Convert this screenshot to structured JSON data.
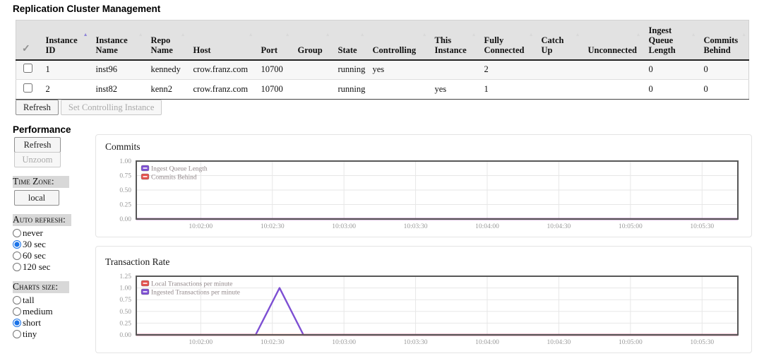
{
  "page": {
    "title": "Replication Cluster Management"
  },
  "cluster_table": {
    "select_icon": "✓",
    "columns": [
      {
        "id": "select",
        "label": "",
        "sort": null
      },
      {
        "id": "instance-id",
        "label": "Instance ID",
        "sort": "active"
      },
      {
        "id": "instance-name",
        "label": "Instance Name",
        "sort": "inactive"
      },
      {
        "id": "repo-name",
        "label": "Repo Name",
        "sort": "inactive"
      },
      {
        "id": "host",
        "label": "Host",
        "sort": "inactive"
      },
      {
        "id": "port",
        "label": "Port",
        "sort": "inactive"
      },
      {
        "id": "group",
        "label": "Group",
        "sort": "inactive"
      },
      {
        "id": "state",
        "label": "State",
        "sort": "inactive"
      },
      {
        "id": "controlling",
        "label": "Controlling",
        "sort": "inactive"
      },
      {
        "id": "this-instance",
        "label": "This Instance",
        "sort": "inactive"
      },
      {
        "id": "fully-connected",
        "label": "Fully Connected",
        "sort": "inactive"
      },
      {
        "id": "catch-up",
        "label": "Catch Up",
        "sort": "inactive"
      },
      {
        "id": "unconnected",
        "label": "Unconnected",
        "sort": "inactive"
      },
      {
        "id": "ingest-queue-length",
        "label": "Ingest Queue Length",
        "sort": "inactive"
      },
      {
        "id": "commits-behind",
        "label": "Commits Behind",
        "sort": "inactive"
      }
    ],
    "rows": [
      {
        "checked": false,
        "cells": [
          "1",
          "inst96",
          "kennedy",
          "crow.franz.com",
          "10700",
          "",
          "running",
          "yes",
          "",
          "2",
          "",
          "",
          "0",
          "0"
        ]
      },
      {
        "checked": false,
        "cells": [
          "2",
          "inst82",
          "kenn2",
          "crow.franz.com",
          "10700",
          "",
          "running",
          "",
          "yes",
          "1",
          "",
          "",
          "0",
          "0"
        ]
      }
    ],
    "buttons": {
      "refresh": "Refresh",
      "set_controlling": "Set Controlling Instance"
    }
  },
  "sidebar": {
    "title": "Performance",
    "refresh_label": "Refresh",
    "unzoom_label": "Unzoom",
    "timezone_label": "Time Zone:",
    "timezone_value": "local",
    "auto_refresh_label": "Auto refresh:",
    "auto_refresh_options": [
      {
        "label": "never",
        "selected": false
      },
      {
        "label": "30 sec",
        "selected": true
      },
      {
        "label": "60 sec",
        "selected": false
      },
      {
        "label": "120 sec",
        "selected": false
      }
    ],
    "charts_size_label": "Charts size:",
    "charts_size_options": [
      {
        "label": "tall",
        "selected": false
      },
      {
        "label": "medium",
        "selected": false
      },
      {
        "label": "short",
        "selected": true
      },
      {
        "label": "tiny",
        "selected": false
      }
    ]
  },
  "colors": {
    "purple_series": "#7d4fd3",
    "red_series": "#e4524e",
    "active_sort_arrow": "#8f85d8",
    "radio_accent": "#1a73e8"
  },
  "chart_data": [
    {
      "type": "line",
      "title": "Commits",
      "x_range": [
        0,
        252
      ],
      "x_ticks": [
        {
          "t": 27,
          "label": "10:02:00"
        },
        {
          "t": 57,
          "label": "10:02:30"
        },
        {
          "t": 87,
          "label": "10:03:00"
        },
        {
          "t": 117,
          "label": "10:03:30"
        },
        {
          "t": 147,
          "label": "10:04:00"
        },
        {
          "t": 177,
          "label": "10:04:30"
        },
        {
          "t": 207,
          "label": "10:05:00"
        },
        {
          "t": 237,
          "label": "10:05:30"
        }
      ],
      "ylim": [
        0,
        1.0
      ],
      "y_ticks": [
        0,
        0.25,
        0.5,
        0.75,
        1.0
      ],
      "grid": true,
      "legend_position": "top-left",
      "series": [
        {
          "name": "Ingest Queue Length",
          "color": "#7d4fd3",
          "points": [
            [
              0,
              0
            ],
            [
              252,
              0
            ]
          ]
        },
        {
          "name": "Commits Behind",
          "color": "#e4524e",
          "points": [
            [
              0,
              0
            ],
            [
              252,
              0
            ]
          ]
        }
      ]
    },
    {
      "type": "line",
      "title": "Transaction Rate",
      "x_range": [
        0,
        252
      ],
      "x_ticks": [
        {
          "t": 27,
          "label": "10:02:00"
        },
        {
          "t": 57,
          "label": "10:02:30"
        },
        {
          "t": 87,
          "label": "10:03:00"
        },
        {
          "t": 117,
          "label": "10:03:30"
        },
        {
          "t": 147,
          "label": "10:04:00"
        },
        {
          "t": 177,
          "label": "10:04:30"
        },
        {
          "t": 207,
          "label": "10:05:00"
        },
        {
          "t": 237,
          "label": "10:05:30"
        }
      ],
      "ylim": [
        0,
        1.25
      ],
      "y_ticks": [
        0,
        0.25,
        0.5,
        0.75,
        1.0,
        1.25
      ],
      "grid": true,
      "legend_position": "top-left",
      "series": [
        {
          "name": "Local Transactions per minute",
          "color": "#e4524e",
          "points": [
            [
              0,
              0
            ],
            [
              252,
              0
            ]
          ]
        },
        {
          "name": "Ingested Transactions per minute",
          "color": "#7d4fd3",
          "points": [
            [
              0,
              0
            ],
            [
              50,
              0
            ],
            [
              60,
              1.0
            ],
            [
              70,
              0
            ],
            [
              252,
              0
            ]
          ]
        }
      ]
    }
  ]
}
